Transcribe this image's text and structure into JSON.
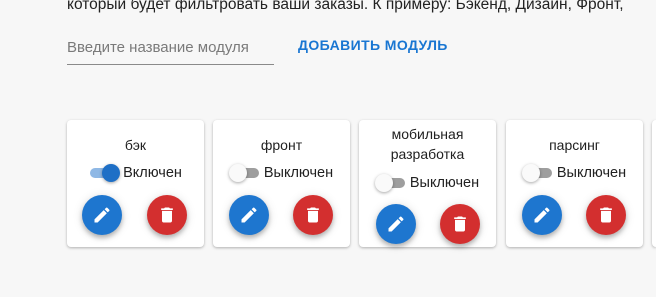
{
  "intro_text": "который будет фильтровать ваши заказы. К примеру: Бэкенд, Дизайн, Фронт,",
  "module_input": {
    "placeholder": "Введите название модуля",
    "value": ""
  },
  "add_button_label": "ДОБАВИТЬ МОДУЛЬ",
  "modules": [
    {
      "title": "бэк",
      "enabled": true,
      "status": "Включен"
    },
    {
      "title": "фронт",
      "enabled": false,
      "status": "Выключен"
    },
    {
      "title": "мобильная разработка",
      "enabled": false,
      "status": "Выключен"
    },
    {
      "title": "парсинг",
      "enabled": false,
      "status": "Выключен"
    }
  ],
  "colors": {
    "primary": "#1976d2",
    "danger": "#d32f2f",
    "switch_on": "#1e6fc6",
    "switch_off_track": "#9e9e9e"
  },
  "icons": {
    "edit": "pencil-icon",
    "delete": "trash-icon"
  }
}
